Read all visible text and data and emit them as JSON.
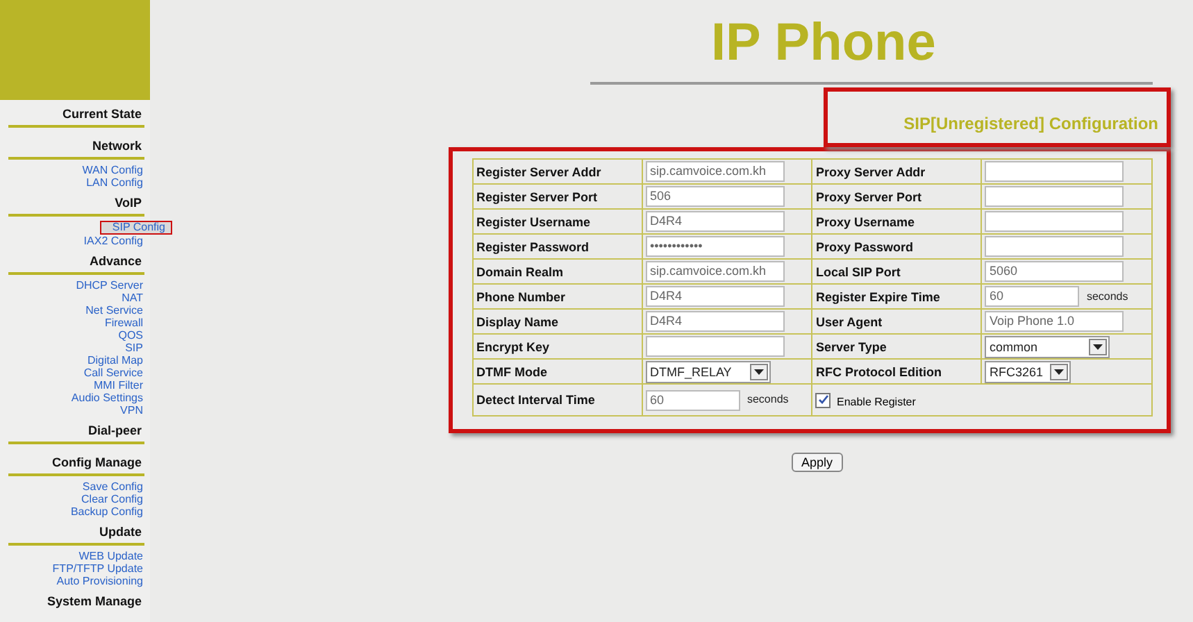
{
  "sidebar": {
    "sections": [
      {
        "heading": "Current State"
      },
      {
        "heading": "Network",
        "items": [
          {
            "label": "WAN Config",
            "selected": false
          },
          {
            "label": "LAN Config",
            "selected": false
          }
        ]
      },
      {
        "heading": "VoIP",
        "items": [
          {
            "label": "SIP Config",
            "selected": true
          },
          {
            "label": "IAX2 Config",
            "selected": false
          }
        ]
      },
      {
        "heading": "Advance",
        "items": [
          {
            "label": "DHCP Server",
            "selected": false
          },
          {
            "label": "NAT",
            "selected": false
          },
          {
            "label": "Net Service",
            "selected": false
          },
          {
            "label": "Firewall",
            "selected": false
          },
          {
            "label": "QOS",
            "selected": false
          },
          {
            "label": "SIP",
            "selected": false
          },
          {
            "label": "Digital Map",
            "selected": false
          },
          {
            "label": "Call Service",
            "selected": false
          },
          {
            "label": "MMI Filter",
            "selected": false
          },
          {
            "label": "Audio Settings",
            "selected": false
          },
          {
            "label": "VPN",
            "selected": false
          }
        ]
      },
      {
        "heading": "Dial-peer"
      },
      {
        "heading": "Config Manage",
        "items": [
          {
            "label": "Save Config",
            "selected": false
          },
          {
            "label": "Clear Config",
            "selected": false
          },
          {
            "label": "Backup Config",
            "selected": false
          }
        ]
      },
      {
        "heading": "Update",
        "items": [
          {
            "label": "WEB Update",
            "selected": false
          },
          {
            "label": "FTP/TFTP Update",
            "selected": false
          },
          {
            "label": "Auto Provisioning",
            "selected": false
          }
        ]
      },
      {
        "heading": "System Manage"
      }
    ]
  },
  "title": "IP Phone",
  "subtitle": "SIP[Unregistered] Configuration",
  "form": {
    "rows": [
      [
        {
          "kind": "text",
          "label": "Register Server Addr",
          "value": "sip.camvoice.com.kh"
        },
        {
          "kind": "text",
          "label": "Proxy Server Addr"
        }
      ],
      [
        {
          "kind": "text",
          "label": "Register Server Port",
          "value": "506"
        },
        {
          "kind": "text",
          "label": "Proxy Server Port"
        }
      ],
      [
        {
          "kind": "text",
          "label": "Register Username",
          "value": "D4R4"
        },
        {
          "kind": "text",
          "label": "Proxy Username"
        }
      ],
      [
        {
          "kind": "password",
          "label": "Register Password",
          "value": "••••••••••••"
        },
        {
          "kind": "password",
          "label": "Proxy Password"
        }
      ],
      [
        {
          "kind": "text",
          "label": "Domain Realm",
          "value": "sip.camvoice.com.kh"
        },
        {
          "kind": "text",
          "label": "Local SIP Port",
          "value": "5060"
        }
      ],
      [
        {
          "kind": "text",
          "label": "Phone Number",
          "value": "D4R4"
        },
        {
          "kind": "short",
          "label": "Register Expire Time",
          "value": "60",
          "unit": "seconds"
        }
      ],
      [
        {
          "kind": "text",
          "label": "Display Name",
          "value": "D4R4"
        },
        {
          "kind": "text",
          "label": "User Agent",
          "value": "Voip Phone 1.0"
        }
      ],
      [
        {
          "kind": "text",
          "label": "Encrypt Key"
        },
        {
          "kind": "select",
          "label": "Server Type",
          "value": "common"
        }
      ],
      [
        {
          "kind": "select",
          "label": "DTMF Mode",
          "value": "DTMF_RELAY"
        },
        {
          "kind": "select-small",
          "label": "RFC Protocol Edition",
          "value": "RFC3261"
        }
      ],
      [
        {
          "kind": "short",
          "label": "Detect Interval Time",
          "value": "60",
          "unit": "seconds"
        },
        {
          "kind": "checkbox",
          "label": "Enable Register",
          "checked": true
        }
      ]
    ]
  },
  "apply_button": "Apply"
}
